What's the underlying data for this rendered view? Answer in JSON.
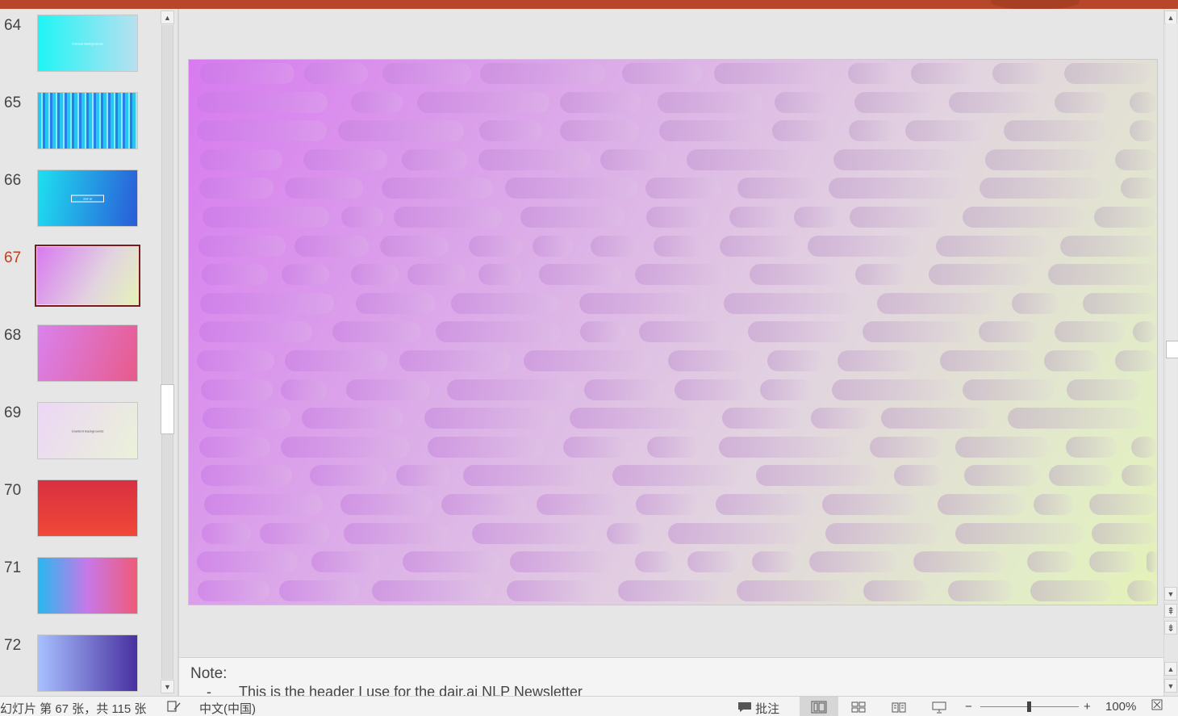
{
  "thumbnails": [
    {
      "num": "64",
      "bg": "linear-gradient(90deg,#1ff5f5,#b8e0f0)",
      "text": "Colored Backgrounds",
      "text_color": "#ffffff"
    },
    {
      "num": "65",
      "bg": "repeating-linear-gradient(90deg,#25c8f0 0 4px,#8ae8ff 4px 6px,#2a7ee8 6px 9px)",
      "text": "",
      "text_color": "#ffffff"
    },
    {
      "num": "66",
      "bg": "linear-gradient(100deg,#1ee0f0,#2a5bd8)",
      "text": "dair.ai",
      "text_color": "#ffffff"
    },
    {
      "num": "67",
      "bg": "linear-gradient(120deg,#d87af0,#e2d4e0 60%,#e4f2b8)",
      "text": "",
      "text_color": "#ffffff",
      "selected": true
    },
    {
      "num": "68",
      "bg": "linear-gradient(110deg,#d982ee,#e85a8a)",
      "text": "",
      "text_color": "#ffffff"
    },
    {
      "num": "69",
      "bg": "linear-gradient(120deg,#ecd6f6,#eaf2d8)",
      "text": "Gradient Backgrounds",
      "text_color": "#555555"
    },
    {
      "num": "70",
      "bg": "linear-gradient(180deg,#d83040,#f04838)",
      "text": "",
      "text_color": "#ffffff"
    },
    {
      "num": "71",
      "bg": "linear-gradient(90deg,#28b8f0,#c878e8,#f05a78)",
      "text": "",
      "text_color": "#ffffff"
    },
    {
      "num": "72",
      "bg": "linear-gradient(90deg,#a8c0ff,#4830a0)",
      "text": "",
      "text_color": "#ffffff"
    }
  ],
  "notes": {
    "label": "Note:",
    "bullet": "-",
    "line1": "This is the header I use for the dair.ai NLP Newsletter"
  },
  "status": {
    "slide_info": "幻灯片 第 67 张，共 115 张",
    "language": "中文(中国)",
    "comments": "批注",
    "zoom_minus": "−",
    "zoom_plus": "+",
    "zoom": "100%"
  },
  "icons": {
    "arrow_up": "▲",
    "arrow_down": "▼",
    "double_up": "⇞",
    "double_down": "⇟",
    "comment": "💬",
    "notes": "🗒",
    "fit": "⛶"
  }
}
